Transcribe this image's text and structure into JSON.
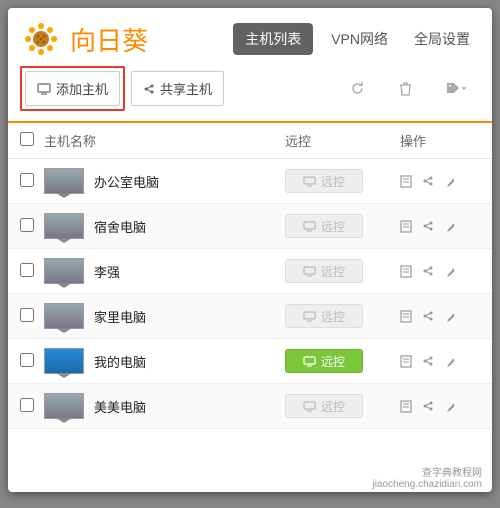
{
  "app": {
    "title": "向日葵"
  },
  "topnav": {
    "hostlist": "主机列表",
    "vpn": "VPN网络",
    "global": "全局设置"
  },
  "toolbar": {
    "add_host": "添加主机",
    "share_host": "共享主机"
  },
  "columns": {
    "name": "主机名称",
    "remote": "远控",
    "ops": "操作"
  },
  "remote_label": "远控",
  "hosts": [
    {
      "name": "办公室电脑",
      "online": false
    },
    {
      "name": "宿舍电脑",
      "online": false
    },
    {
      "name": "李强",
      "online": false
    },
    {
      "name": "家里电脑",
      "online": false
    },
    {
      "name": "我的电脑",
      "online": true
    },
    {
      "name": "美美电脑",
      "online": false
    }
  ],
  "watermark": {
    "line1": "查字典教程网",
    "line2": "jiaocheng.chazidian.com"
  }
}
